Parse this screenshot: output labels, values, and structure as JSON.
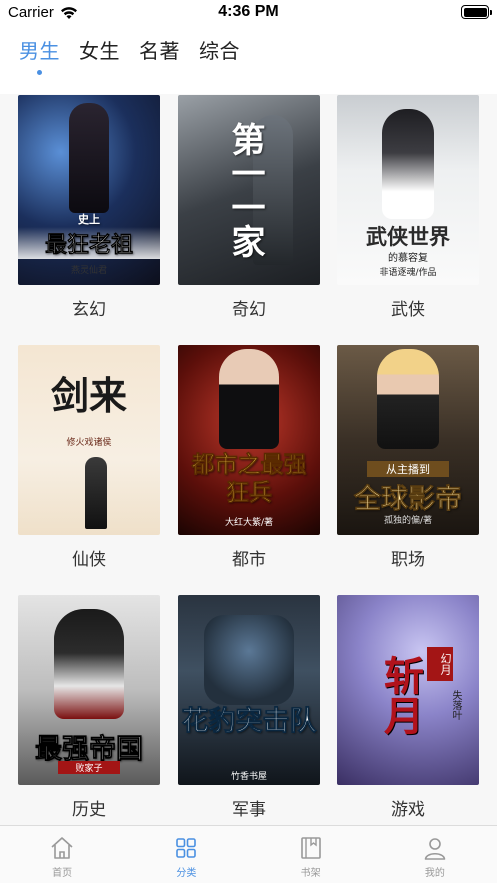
{
  "status_bar": {
    "carrier": "Carrier",
    "time": "4:36 PM"
  },
  "tabs": [
    {
      "label": "男生",
      "active": true
    },
    {
      "label": "女生",
      "active": false
    },
    {
      "label": "名著",
      "active": false
    },
    {
      "label": "综合",
      "active": false
    }
  ],
  "categories": [
    {
      "label": "玄幻",
      "cover_title": "最狂老祖",
      "cover_sub": "史上",
      "cover_author": "燕灵仙君"
    },
    {
      "label": "奇幻",
      "cover_title": "第一一家",
      "cover_sub": "",
      "cover_author": ""
    },
    {
      "label": "武侠",
      "cover_title": "武侠世界",
      "cover_sub": "的慕容复",
      "cover_author": "非语逐魂/作品"
    },
    {
      "label": "仙侠",
      "cover_title": "剑来",
      "cover_sub": "",
      "cover_author": "修火戏诸侯"
    },
    {
      "label": "都市",
      "cover_title": "都市之最强狂兵",
      "cover_sub": "",
      "cover_author": "大红大紫/著"
    },
    {
      "label": "职场",
      "cover_title": "全球影帝",
      "cover_sub": "从主播到",
      "cover_author": "孤独的偏/著"
    },
    {
      "label": "历史",
      "cover_title": "最强帝国",
      "cover_sub": "",
      "cover_author": "败家子"
    },
    {
      "label": "军事",
      "cover_title": "花豹突击队",
      "cover_sub": "",
      "cover_author": "竹香书屋"
    },
    {
      "label": "游戏",
      "cover_title": "斩月",
      "cover_sub": "幻月",
      "cover_author": "失落叶"
    }
  ],
  "tabbar": [
    {
      "label": "首页",
      "icon": "home-icon",
      "active": false
    },
    {
      "label": "分类",
      "icon": "category-grid-icon",
      "active": true
    },
    {
      "label": "书架",
      "icon": "bookshelf-icon",
      "active": false
    },
    {
      "label": "我的",
      "icon": "profile-icon",
      "active": false
    }
  ],
  "colors": {
    "accent": "#4a90e2",
    "text": "#222222",
    "inactive": "#999999",
    "background": "#f7f7f7"
  }
}
